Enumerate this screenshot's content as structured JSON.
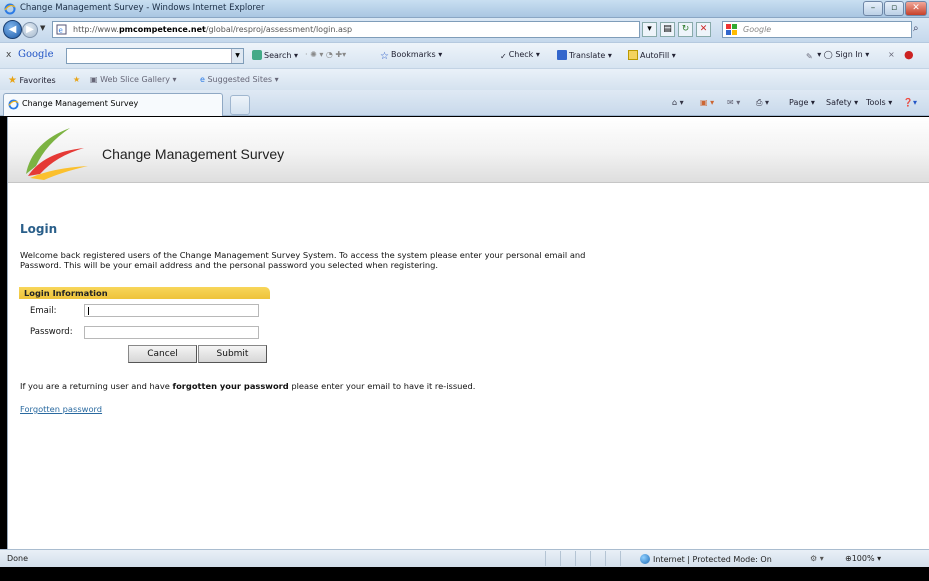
{
  "window": {
    "title": "Change Management Survey - Windows Internet Explorer"
  },
  "address": {
    "url_prefix": "http://www.",
    "url_domain": "pmcompetence.net",
    "url_path": "/global/resproj/assessment/login.asp",
    "search_placeholder": "Google"
  },
  "google_toolbar": {
    "logo": "Google",
    "search_label": "Search",
    "bookmarks_label": "Bookmarks",
    "check_label": "Check",
    "translate_label": "Translate",
    "autofill_label": "AutoFill",
    "signin_label": "Sign In"
  },
  "favorites": {
    "favorites_label": "Favorites",
    "web_slice_label": "Web Slice Gallery",
    "suggested_label": "Suggested Sites"
  },
  "tabs": {
    "active_tab": "Change Management Survey"
  },
  "commandbar": {
    "page_label": "Page",
    "safety_label": "Safety",
    "tools_label": "Tools"
  },
  "page": {
    "banner_title": "Change Management Survey",
    "heading": "Login",
    "welcome_line1": "Welcome back registered users of the Change Management Survey System. To access the system please enter your personal email and",
    "welcome_line2": "Password. This will be your email address and the personal password you selected when registering.",
    "login_info_header": "Login Information",
    "email_label": "Email:",
    "password_label": "Password:",
    "email_value": "",
    "password_value": "",
    "cancel_label": "Cancel",
    "submit_label": "Submit",
    "forgot_msg_pre": "If you are a returning user and have ",
    "forgot_msg_bold": "forgotten your password",
    "forgot_msg_post": " please enter your email to have it re-issued.",
    "forgot_link": "Forgotten password"
  },
  "status": {
    "left_text": "Done",
    "zone_text": "Internet | Protected Mode: On",
    "zoom_text": "100%"
  },
  "colors": {
    "heading": "#2a5f8a",
    "header_bar": "#f0c53e",
    "link": "#2a6aa0"
  }
}
